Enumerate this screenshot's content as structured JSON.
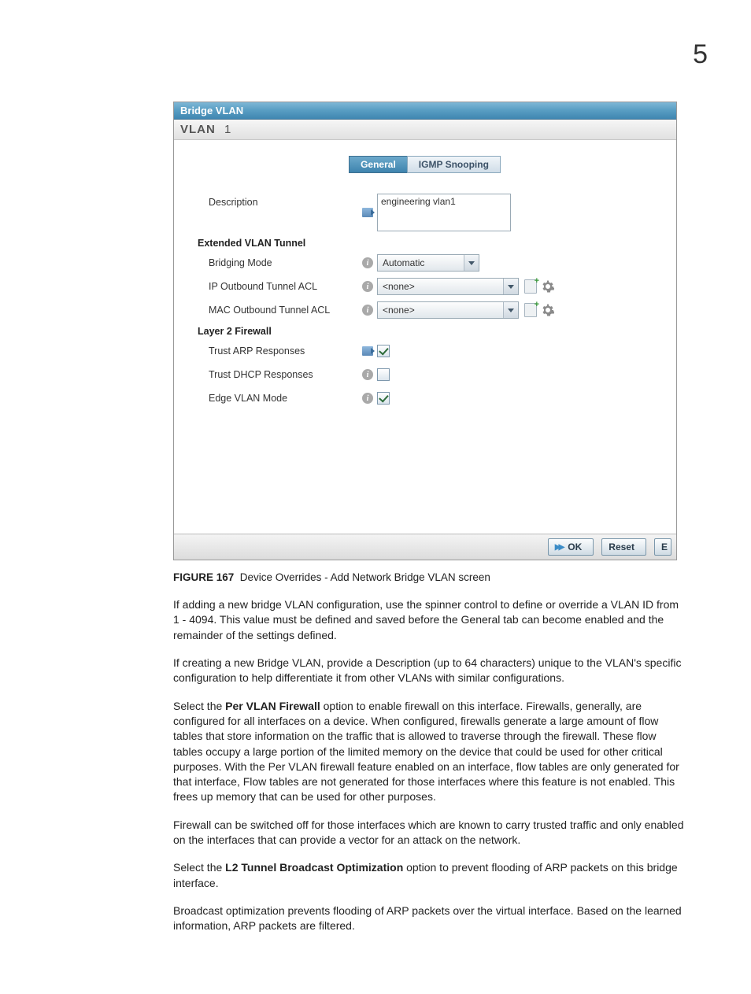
{
  "page_number": "5",
  "screenshot": {
    "titlebar": "Bridge VLAN",
    "subtitle_prefix": "VLAN",
    "subtitle_value": "1",
    "tabs": {
      "general": "General",
      "igmp": "IGMP Snooping"
    },
    "fields": {
      "description_label": "Description",
      "description_value": "engineering vlan1",
      "section_ext_tunnel": "Extended VLAN Tunnel",
      "bridging_mode_label": "Bridging Mode",
      "bridging_mode_value": "Automatic",
      "ip_outbound_label": "IP Outbound Tunnel ACL",
      "ip_outbound_value": "<none>",
      "mac_outbound_label": "MAC Outbound Tunnel ACL",
      "mac_outbound_value": "<none>",
      "section_l2fw": "Layer 2 Firewall",
      "trust_arp_label": "Trust ARP Responses",
      "trust_dhcp_label": "Trust DHCP Responses",
      "edge_vlan_label": "Edge VLAN Mode"
    },
    "buttons": {
      "ok": "OK",
      "reset": "Reset",
      "exit_partial": "E"
    }
  },
  "caption": {
    "figure_label": "FIGURE 167",
    "figure_text": "Device Overrides - Add Network Bridge VLAN screen"
  },
  "paragraphs": {
    "p1": "If adding a new bridge VLAN configuration, use the spinner control to define or override a VLAN ID from 1 - 4094. This value must be defined and saved before the General tab can become enabled and the remainder of the settings defined.",
    "p2": "If creating a new Bridge VLAN, provide a Description (up to 64 characters) unique to the VLAN's specific configuration to help differentiate it from other VLANs with similar configurations.",
    "p3_pre": "Select the ",
    "p3_bold": "Per VLAN Firewall",
    "p3_post": " option to enable firewall on this interface. Firewalls, generally, are configured for all interfaces on a device. When configured, firewalls generate a large amount of flow tables that store information on the traffic that is allowed to traverse through the firewall. These flow tables occupy a large portion of the limited memory on the device that could be used for other critical purposes. With the Per VLAN firewall feature enabled on an interface, flow tables are only generated for that interface, Flow tables are not generated for those interfaces where this feature is not enabled. This frees up memory that can be used for other purposes.",
    "p4": "Firewall can be switched off for those interfaces which are known to carry trusted traffic and only enabled on the interfaces that can provide a vector for an attack on the network.",
    "p5_pre": "Select the ",
    "p5_bold": "L2 Tunnel Broadcast Optimization",
    "p5_post": " option to prevent flooding of ARP packets on this bridge interface.",
    "p6": "Broadcast optimization prevents flooding of ARP packets over the virtual interface. Based on the learned information, ARP packets are filtered."
  }
}
